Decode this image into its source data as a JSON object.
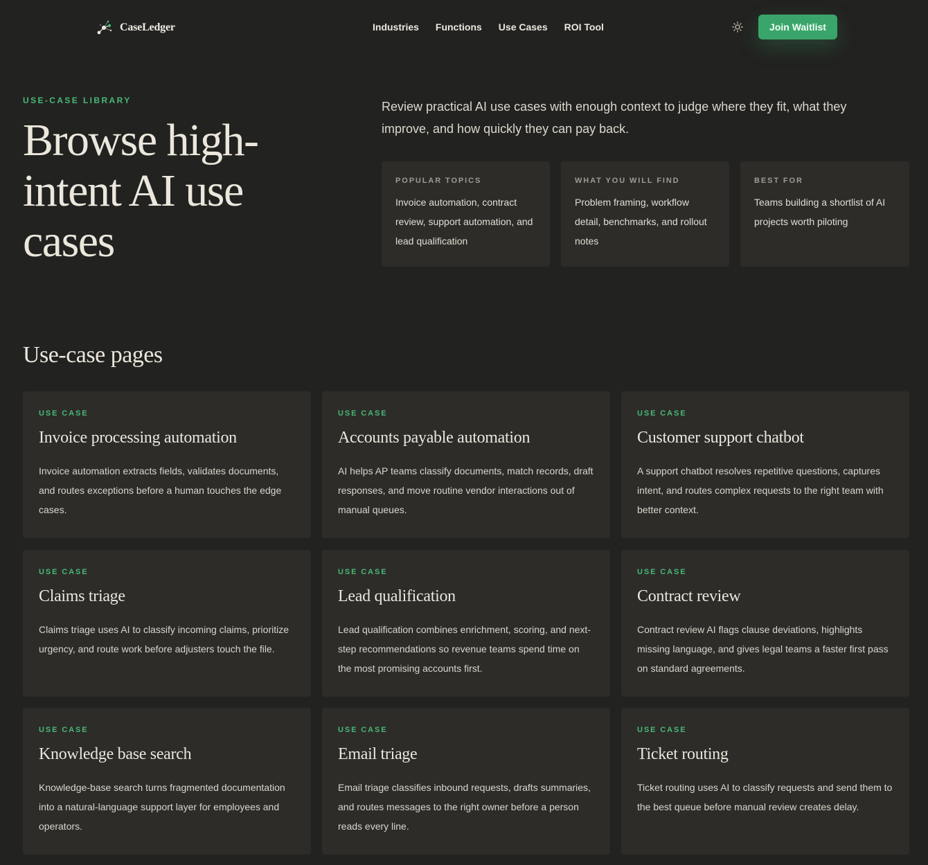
{
  "header": {
    "brand": "CaseLedger",
    "nav": [
      "Industries",
      "Functions",
      "Use Cases",
      "ROI Tool"
    ],
    "cta": "Join Waitlist"
  },
  "hero": {
    "eyebrow": "USE-CASE LIBRARY",
    "title": "Browse high-intent AI use cases",
    "description": "Review practical AI use cases with enough context to judge where they fit, what they improve, and how quickly they can pay back.",
    "cards": [
      {
        "label": "POPULAR TOPICS",
        "text": "Invoice automation, contract review, support automation, and lead qualification"
      },
      {
        "label": "WHAT YOU WILL FIND",
        "text": "Problem framing, workflow detail, benchmarks, and rollout notes"
      },
      {
        "label": "BEST FOR",
        "text": "Teams building a shortlist of AI projects worth piloting"
      }
    ]
  },
  "section": {
    "title": "Use-case pages",
    "cards": [
      {
        "tag": "USE CASE",
        "title": "Invoice processing automation",
        "description": "Invoice automation extracts fields, validates documents, and routes exceptions before a human touches the edge cases."
      },
      {
        "tag": "USE CASE",
        "title": "Accounts payable automation",
        "description": "AI helps AP teams classify documents, match records, draft responses, and move routine vendor interactions out of manual queues."
      },
      {
        "tag": "USE CASE",
        "title": "Customer support chatbot",
        "description": "A support chatbot resolves repetitive questions, captures intent, and routes complex requests to the right team with better context."
      },
      {
        "tag": "USE CASE",
        "title": "Claims triage",
        "description": "Claims triage uses AI to classify incoming claims, prioritize urgency, and route work before adjusters touch the file."
      },
      {
        "tag": "USE CASE",
        "title": "Lead qualification",
        "description": "Lead qualification combines enrichment, scoring, and next-step recommendations so revenue teams spend time on the most promising accounts first."
      },
      {
        "tag": "USE CASE",
        "title": "Contract review",
        "description": "Contract review AI flags clause deviations, highlights missing language, and gives legal teams a faster first pass on standard agreements."
      },
      {
        "tag": "USE CASE",
        "title": "Knowledge base search",
        "description": "Knowledge-base search turns fragmented documentation into a natural-language support layer for employees and operators."
      },
      {
        "tag": "USE CASE",
        "title": "Email triage",
        "description": "Email triage classifies inbound requests, drafts summaries, and routes messages to the right owner before a person reads every line."
      },
      {
        "tag": "USE CASE",
        "title": "Ticket routing",
        "description": "Ticket routing uses AI to classify requests and send them to the best queue before manual review creates delay."
      }
    ]
  },
  "colors": {
    "background": "#222220",
    "card": "#2d2c29",
    "accent": "#48b877",
    "button": "#3aa56a"
  },
  "icons": {
    "logo": "constellation-logo-icon",
    "theme": "sun-icon"
  }
}
